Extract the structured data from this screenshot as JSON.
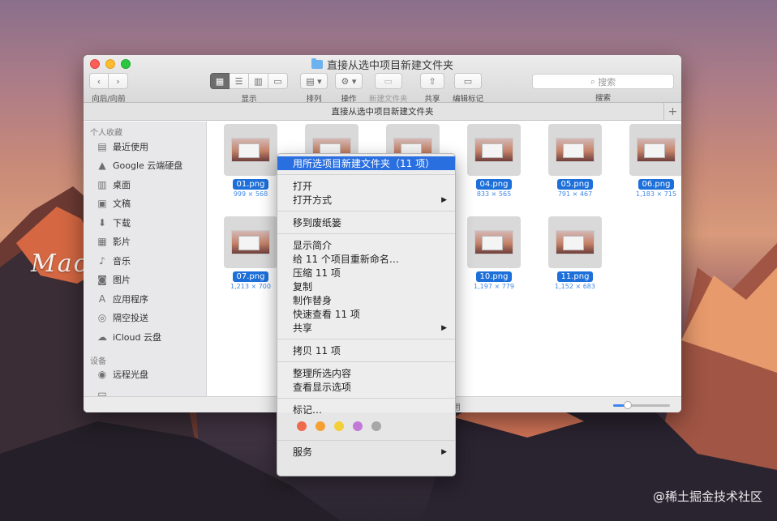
{
  "window": {
    "title": "直接从选中项目新建文件夹",
    "tab_title": "直接从选中项目新建文件夹",
    "toolbar": {
      "nav_label": "向后/向前",
      "view_label": "显示",
      "arrange_label": "排列",
      "action_label": "操作",
      "new_folder_label": "新建文件夹",
      "share_label": "共享",
      "edit_tags_label": "编辑标记",
      "search_placeholder": "搜索",
      "search_label": "搜索"
    }
  },
  "sidebar": {
    "favorites_header": "个人收藏",
    "favorites": [
      {
        "label": "最近使用",
        "icon": "recents-icon",
        "glyph": "▤"
      },
      {
        "label": "Google 云端硬盘",
        "icon": "google-drive-icon",
        "glyph": "▲"
      },
      {
        "label": "桌面",
        "icon": "desktop-icon",
        "glyph": "▥"
      },
      {
        "label": "文稿",
        "icon": "documents-icon",
        "glyph": "▣"
      },
      {
        "label": "下载",
        "icon": "downloads-icon",
        "glyph": "⬇"
      },
      {
        "label": "影片",
        "icon": "movies-icon",
        "glyph": "▦"
      },
      {
        "label": "音乐",
        "icon": "music-icon",
        "glyph": "♪"
      },
      {
        "label": "图片",
        "icon": "pictures-icon",
        "glyph": "◙"
      },
      {
        "label": "应用程序",
        "icon": "applications-icon",
        "glyph": "A"
      },
      {
        "label": "隔空投送",
        "icon": "airdrop-icon",
        "glyph": "◎"
      },
      {
        "label": "iCloud 云盘",
        "icon": "icloud-icon",
        "glyph": "☁"
      }
    ],
    "devices_header": "设备",
    "devices": [
      {
        "label": "远程光盘",
        "icon": "remote-disc-icon",
        "glyph": "◉"
      },
      {
        "label": "",
        "icon": "disk-icon",
        "glyph": "▭"
      }
    ]
  },
  "files": [
    {
      "name": "01.png",
      "dims": "999 × 568"
    },
    {
      "name": "04.png",
      "dims": "833 × 565"
    },
    {
      "name": "05.png",
      "dims": "791 × 467"
    },
    {
      "name": "06.png",
      "dims": "1,183 × 715"
    },
    {
      "name": "07.png",
      "dims": "1,213 × 700"
    },
    {
      "name": "10.png",
      "dims": "1,197 × 779"
    },
    {
      "name": "11.png",
      "dims": "1,152 × 683"
    }
  ],
  "statusbar": {
    "text": "用",
    "zoom_level": 0.25
  },
  "context_menu": {
    "items": [
      {
        "label": "用所选项目新建文件夹（11 项）",
        "highlight": true
      },
      {
        "sep": true
      },
      {
        "label": "打开"
      },
      {
        "label": "打开方式",
        "submenu": true
      },
      {
        "sep": true
      },
      {
        "label": "移到废纸篓"
      },
      {
        "sep": true
      },
      {
        "label": "显示简介"
      },
      {
        "label": "给 11 个项目重新命名…"
      },
      {
        "label": "压缩 11 项"
      },
      {
        "label": "复制"
      },
      {
        "label": "制作替身"
      },
      {
        "label": "快速查看 11 项"
      },
      {
        "label": "共享",
        "submenu": true
      },
      {
        "sep": true
      },
      {
        "label": "拷贝 11 项"
      },
      {
        "sep": true
      },
      {
        "label": "整理所选内容"
      },
      {
        "label": "查看显示选项"
      },
      {
        "sep": true
      },
      {
        "label": "标记…"
      },
      {
        "tags": true
      },
      {
        "sep": true
      },
      {
        "label": "服务",
        "submenu": true
      }
    ],
    "tag_colors": [
      "#ee6a4c",
      "#f5a032",
      "#f2cf3b",
      "#c379d8",
      "#a7a7a7"
    ],
    "submenu_arrow": "▶"
  },
  "watermarks": {
    "left": "Mac.orsoon.com",
    "right": "@稀土掘金技术社区"
  },
  "colors": {
    "accent": "#2a6fe0",
    "filename_badge": "#1d6fd9"
  }
}
